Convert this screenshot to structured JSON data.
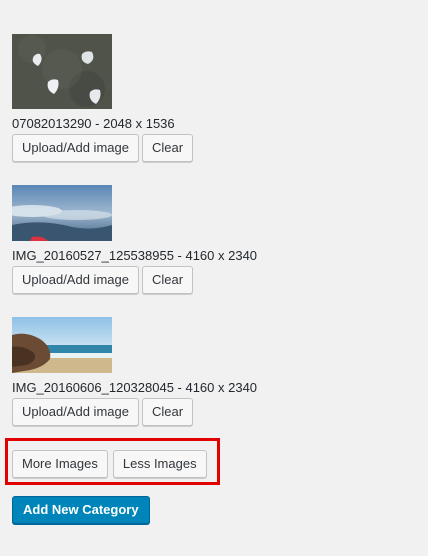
{
  "images": [
    {
      "caption": "07082013290 - 2048 x 1536",
      "upload_label": "Upload/Add image",
      "clear_label": "Clear"
    },
    {
      "caption": "IMG_20160527_125538955 - 4160 x 2340",
      "upload_label": "Upload/Add image",
      "clear_label": "Clear"
    },
    {
      "caption": "IMG_20160606_120328045 - 4160 x 2340",
      "upload_label": "Upload/Add image",
      "clear_label": "Clear"
    }
  ],
  "controls": {
    "more_images_label": "More Images",
    "less_images_label": "Less Images",
    "add_category_label": "Add New Category"
  },
  "colors": {
    "highlight": "#e00000",
    "primary": "#0085ba"
  }
}
